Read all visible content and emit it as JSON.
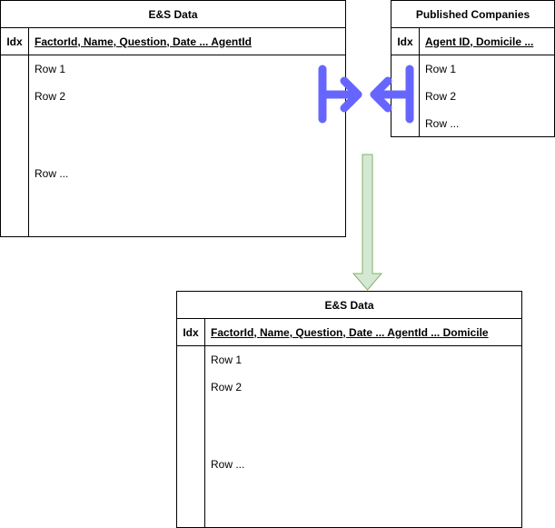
{
  "left_table": {
    "title": "E&S Data",
    "idx_header": "Idx",
    "columns_header": "FactorId, Name, Question, Date ... AgentId",
    "rows": [
      "Row 1",
      "Row 2",
      "Row ..."
    ]
  },
  "right_table": {
    "title": "Published Companies",
    "idx_header": "Idx",
    "columns_header": "Agent ID, Domicile ...",
    "rows": [
      "Row 1",
      "Row 2",
      "Row ..."
    ]
  },
  "result_table": {
    "title": "E&S Data",
    "idx_header": "Idx",
    "columns_header": "FactorId, Name, Question, Date ... AgentId ... Domicile",
    "rows": [
      "Row 1",
      "Row 2",
      "Row ..."
    ]
  },
  "colors": {
    "join_symbol": "#6666ff",
    "down_arrow_fill": "#d5e8d4",
    "down_arrow_stroke": "#82b366",
    "border": "#000000"
  }
}
